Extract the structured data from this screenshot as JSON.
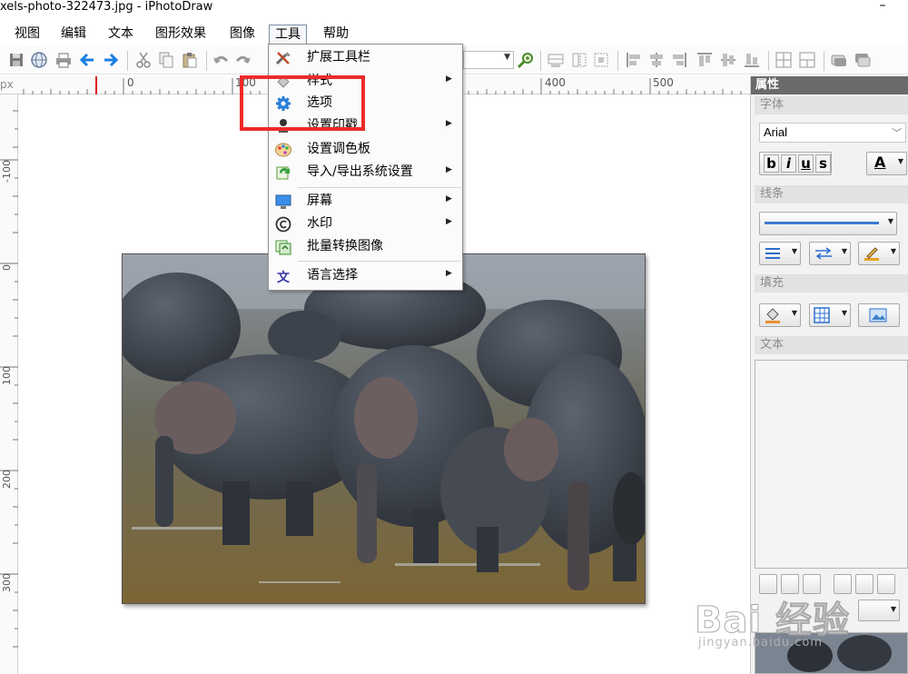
{
  "window": {
    "title": "xels-photo-322473.jpg - iPhotoDraw",
    "minimize_glyph": "–"
  },
  "menubar": {
    "items": [
      "视图",
      "编辑",
      "文本",
      "图形效果",
      "图像",
      "工具",
      "帮助"
    ],
    "active_item": "工具"
  },
  "toolbar": {
    "icons": [
      "save-icon",
      "globe-icon",
      "print-icon",
      "back-arrow-icon",
      "forward-arrow-icon",
      "cut-icon",
      "copy-icon",
      "paste-icon",
      "undo-icon",
      "redo-icon",
      "zoom-icon",
      "align-icons"
    ]
  },
  "ruler": {
    "unit": "px",
    "h_labels": [
      "0",
      "100",
      "400",
      "500"
    ],
    "v_labels": [
      "-100",
      "0",
      "100",
      "200",
      "300"
    ]
  },
  "tools_menu": {
    "items": [
      {
        "label": "扩展工具栏",
        "icon": "tools-icon",
        "submenu": false
      },
      {
        "label": "样式",
        "icon": "style-icon",
        "submenu": true
      },
      {
        "label": "选项",
        "icon": "gear-icon",
        "submenu": false
      },
      {
        "label": "设置印戳",
        "icon": "stamp-icon",
        "submenu": true
      },
      {
        "label": "设置调色板",
        "icon": "palette-icon",
        "submenu": false
      },
      {
        "label": "导入/导出系统设置",
        "icon": "import-export-icon",
        "submenu": true
      },
      {
        "label": "屏幕",
        "icon": "monitor-icon",
        "submenu": true
      },
      {
        "label": "水印",
        "icon": "copyright-icon",
        "submenu": true
      },
      {
        "label": "批量转换图像",
        "icon": "batch-convert-icon",
        "submenu": false
      },
      {
        "label": "语言选择",
        "icon": "language-icon",
        "submenu": true
      }
    ],
    "submenu_arrow": "▶"
  },
  "properties_panel": {
    "title": "属性",
    "sections": {
      "font": "字体",
      "line": "线条",
      "fill": "填充",
      "text": "文本"
    },
    "font_name": "Arial",
    "font_buttons": [
      "b",
      "i",
      "u",
      "s"
    ],
    "font_color_button": "A"
  },
  "watermark": {
    "logo_text": "Bai 经验",
    "url_text": "jingyan.baidu.com"
  },
  "colors": {
    "highlight": "#ee2a2a",
    "panel_title_bg": "#6a6a6a",
    "toolbar_arrow_blue": "#1a7fe0"
  }
}
